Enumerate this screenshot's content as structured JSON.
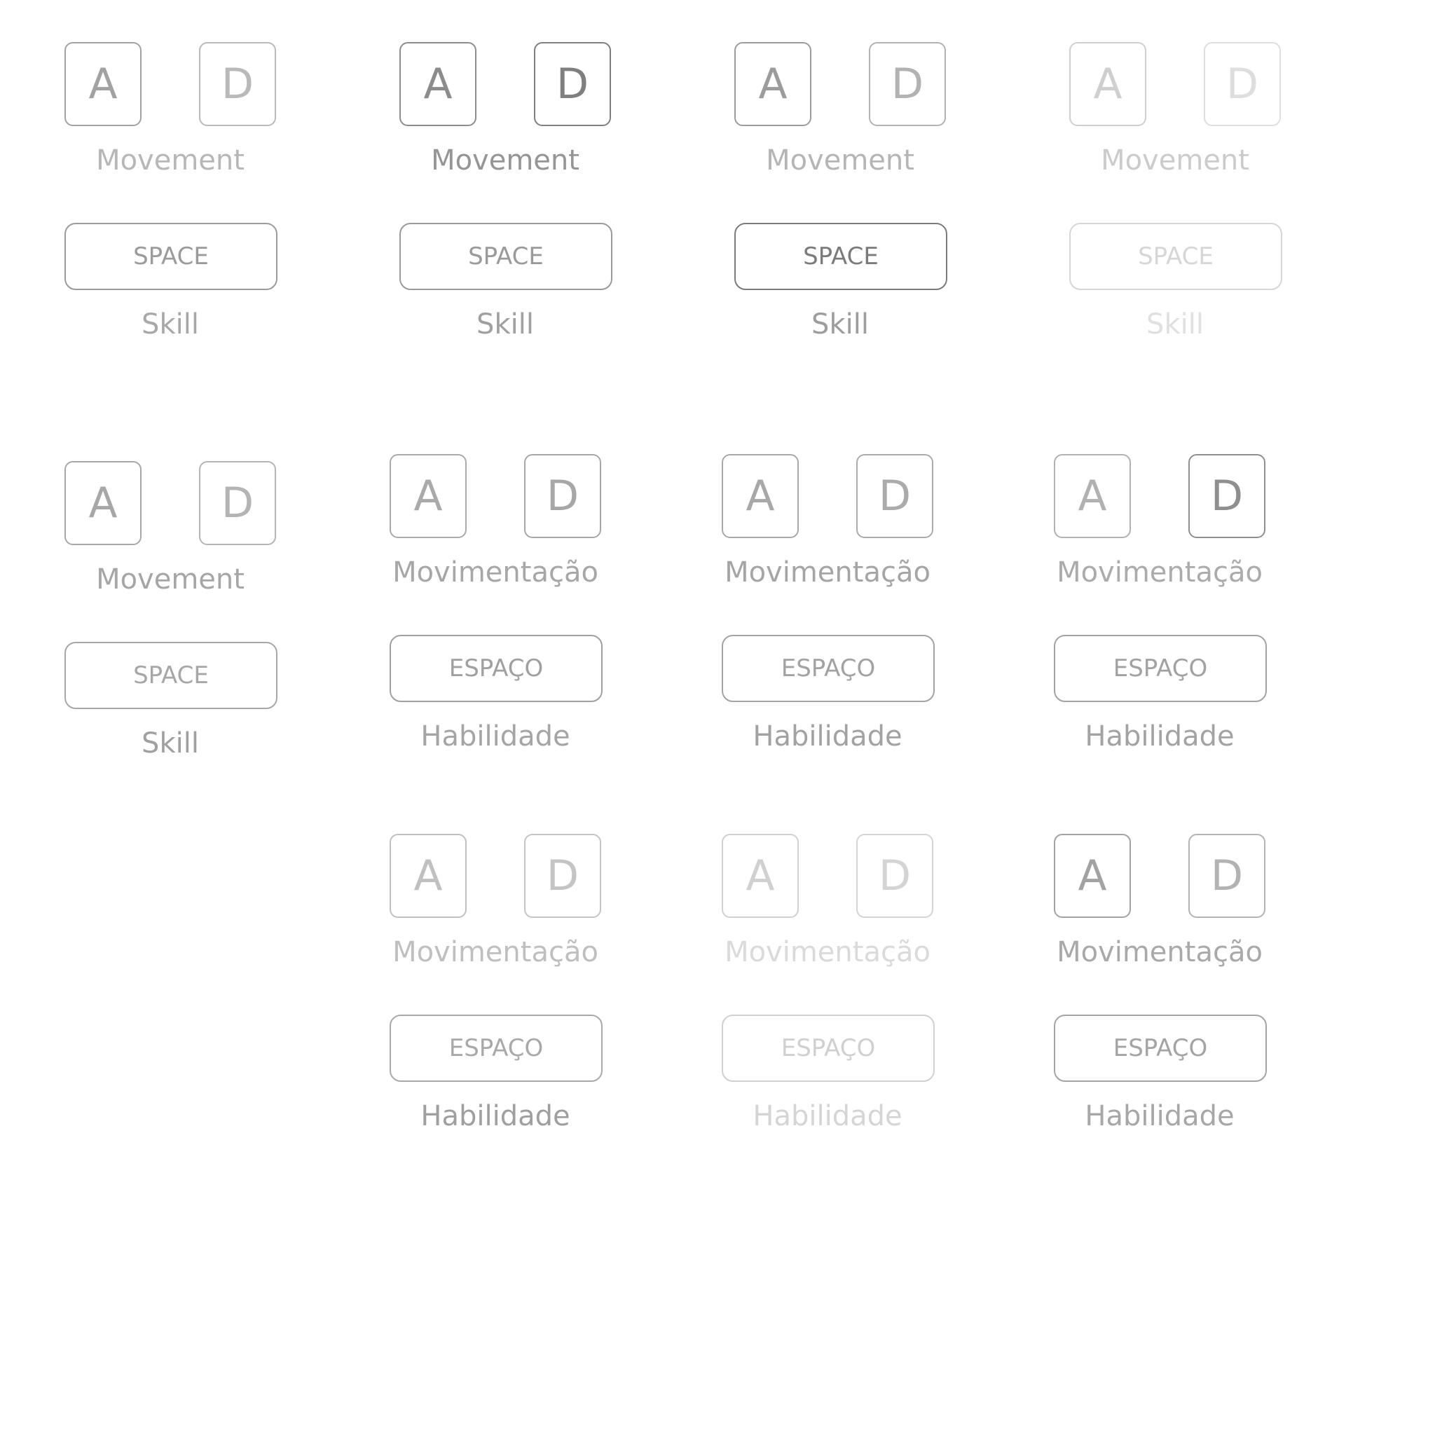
{
  "colors": {
    "background": "#ffffff"
  },
  "panels": [
    {
      "key_a": "A",
      "key_d": "D",
      "movement_label": "Movement",
      "key_space": "SPACE",
      "skill_label": "Skill",
      "color_a": "#a2a2a2",
      "color_d": "#b9b9b9",
      "color_move": "#b7b7b7",
      "color_space": "#9b9b9b",
      "color_skill": "#a8a8a8"
    },
    {
      "key_a": "A",
      "key_d": "D",
      "movement_label": "Movement",
      "key_space": "SPACE",
      "skill_label": "Skill",
      "color_a": "#8c8c8c",
      "color_d": "#7f7f7f",
      "color_move": "#959595",
      "color_space": "#9a9a9a",
      "color_skill": "#a0a0a0"
    },
    {
      "key_a": "A",
      "key_d": "D",
      "movement_label": "Movement",
      "key_space": "SPACE",
      "skill_label": "Skill",
      "color_a": "#9c9c9c",
      "color_d": "#b2b2b2",
      "color_move": "#b5b5b5",
      "color_space": "#7b7b7b",
      "color_skill": "#9d9d9d"
    },
    {
      "key_a": "A",
      "key_d": "D",
      "movement_label": "Movement",
      "key_space": "SPACE",
      "skill_label": "Skill",
      "color_a": "#cfcfcf",
      "color_d": "#dedede",
      "color_move": "#cbcbcb",
      "color_space": "#d6d6d6",
      "color_skill": "#e0e0e0"
    },
    {
      "key_a": "A",
      "key_d": "D",
      "movement_label": "Movement",
      "key_space": "SPACE",
      "skill_label": "Skill",
      "color_a": "#a7a7a7",
      "color_d": "#b4b4b4",
      "color_move": "#a6a6a6",
      "color_space": "#a7a7a7",
      "color_skill": "#a0a0a0"
    },
    {
      "key_a": "A",
      "key_d": "D",
      "movement_label": "Movimentação",
      "key_space": "ESPAÇO",
      "skill_label": "Habilidade",
      "color_a": "#aaaaaa",
      "color_d": "#a7a7a7",
      "color_move": "#a7a7a7",
      "color_space": "#a0a0a0",
      "color_skill": "#a5a5a5"
    },
    {
      "key_a": "A",
      "key_d": "D",
      "movement_label": "Movimentação",
      "key_space": "ESPAÇO",
      "skill_label": "Habilidade",
      "color_a": "#a8a8a8",
      "color_d": "#ababab",
      "color_move": "#a5a5a5",
      "color_space": "#a3a3a3",
      "color_skill": "#a2a2a2"
    },
    {
      "key_a": "A",
      "key_d": "D",
      "movement_label": "Movimentação",
      "key_space": "ESPAÇO",
      "skill_label": "Habilidade",
      "color_a": "#b1b1b1",
      "color_d": "#8f8f8f",
      "color_move": "#ababab",
      "color_space": "#a2a2a2",
      "color_skill": "#a3a3a3"
    },
    {
      "key_a": "A",
      "key_d": "D",
      "movement_label": "Movimentação",
      "key_space": "ESPAÇO",
      "skill_label": "Habilidade",
      "color_a": "#c0c0c0",
      "color_d": "#c4c4c4",
      "color_move": "#bfbfbf",
      "color_space": "#a9a9a9",
      "color_skill": "#9f9f9f"
    },
    {
      "key_a": "A",
      "key_d": "D",
      "movement_label": "Movimentação",
      "key_space": "ESPAÇO",
      "skill_label": "Habilidade",
      "color_a": "#d0d0d0",
      "color_d": "#d4d4d4",
      "color_move": "#dadada",
      "color_space": "#d0d0d0",
      "color_skill": "#d5d5d5"
    },
    {
      "key_a": "A",
      "key_d": "D",
      "movement_label": "Movimentação",
      "key_space": "ESPAÇO",
      "skill_label": "Habilidade",
      "color_a": "#a2a2a2",
      "color_d": "#b3b3b3",
      "color_move": "#a9a9a9",
      "color_space": "#a4a4a4",
      "color_skill": "#a7a7a7"
    }
  ]
}
